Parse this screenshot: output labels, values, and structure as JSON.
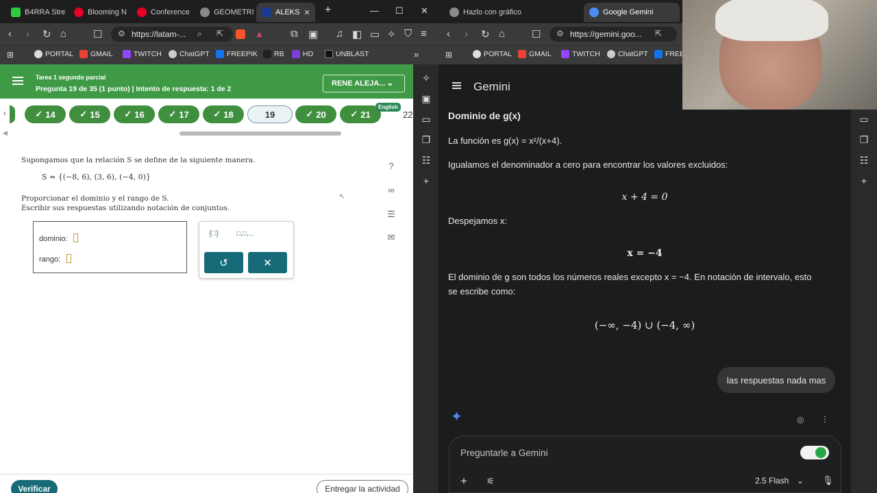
{
  "left_window": {
    "tabs": [
      {
        "label": "B4RRA Stre",
        "color": "#2ecc40"
      },
      {
        "label": "Blooming N",
        "color": "#e60023"
      },
      {
        "label": "Conference",
        "color": "#e60023"
      },
      {
        "label": "GEOMETRI",
        "color": "#8a8a8a"
      },
      {
        "label": "ALEKS",
        "color": "#1a3b8f",
        "active": true
      }
    ],
    "url": "https://latam-...",
    "bookmarks": [
      "PORTAL",
      "GMAIL",
      "TWITCH",
      "ChatGPT",
      "FREEPIK",
      "RB",
      "HD",
      "UNBLAST"
    ]
  },
  "aleks": {
    "assignment": "Tarea 1 segundo parcial",
    "question_info": "Pregunta 19 de 35 (1 punto)  |  Intento de respuesta: 1 de 2",
    "user_button": "RENE ALEJA...",
    "language_badge": "English",
    "questions": [
      "14",
      "15",
      "16",
      "17",
      "18",
      "19",
      "20",
      "21"
    ],
    "next_question_peek": "22",
    "current_question": "19",
    "problem": {
      "line1": "Supongamos que la relación S se define de la siguiente manera.",
      "set": "S = {(−8, 6), (3, 6), (−4, 0)}",
      "line2": "Proporcionar el dominio y el rango de S.",
      "line3": "Escribir sus respuestas utilizando notación de conjuntos."
    },
    "answer_fields": [
      {
        "label": "dominio:"
      },
      {
        "label": "rango:"
      }
    ],
    "palette": {
      "set_symbol": "{□}",
      "list_symbol": "□,□,...",
      "undo": "↺",
      "clear": "✕"
    },
    "verify_button": "Verificar",
    "submit_button": "Entregar la actividad"
  },
  "right_window": {
    "tabs": [
      {
        "label": "Hazlo con gráfico",
        "color": "#8a8a8a"
      },
      {
        "label": "Google Gemini",
        "color": "#4d8df6",
        "active": true
      }
    ],
    "url": "https://gemini.goo...",
    "bookmarks": [
      "PORTAL",
      "GMAIL",
      "TWITCH",
      "ChatGPT",
      "FREE"
    ]
  },
  "gemini": {
    "app_title": "Gemini",
    "heading": "Dominio de g(x)",
    "function_line": "La función es g(x) = x²/(x+4).",
    "step1": "Igualamos el denominador a cero para encontrar los valores excluidos:",
    "eq1": "x + 4 = 0",
    "step2": "Despejamos x:",
    "eq2": "x = −4",
    "conclusion_line1": "El dominio de g son todos los números reales excepto x = −4. En notación de intervalo, esto",
    "conclusion_line2": "se escribe como:",
    "interval": "(−∞, −4) ∪ (−4, ∞)",
    "user_message": "las respuestas nada mas",
    "input_placeholder": "Preguntarle a Gemini",
    "model": "2.5 Flash"
  }
}
